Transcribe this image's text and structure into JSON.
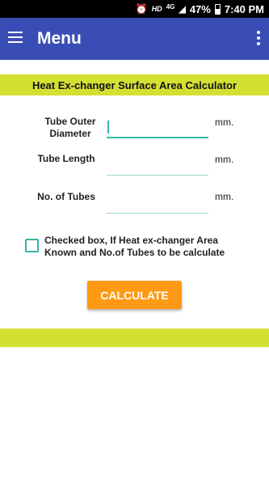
{
  "status_bar": {
    "hd": "HD",
    "network": "4G",
    "battery": "47%",
    "time": "7:40 PM",
    "battery_level": 0.47
  },
  "appbar": {
    "title": "Menu"
  },
  "banner": {
    "title": "Heat Ex-changer Surface Area Calculator"
  },
  "form": {
    "fields": [
      {
        "label_line1": "Tube Outer",
        "label_line2": "Diameter",
        "value": "",
        "unit": "mm."
      },
      {
        "label": "Tube Length",
        "value": "",
        "unit": "mm."
      },
      {
        "label": "No. of Tubes",
        "value": "",
        "unit": "mm."
      }
    ],
    "checkbox_line1": "Checked box, If Heat ex-changer Area",
    "checkbox_line2": "Known and No.of Tubes to be calculate",
    "checkbox_checked": false,
    "button_label": "CALCULATE"
  },
  "colors": {
    "appbar": "#3a4db5",
    "banner": "#d4df34",
    "accent": "#35b6a8",
    "button": "#ff9a15"
  }
}
